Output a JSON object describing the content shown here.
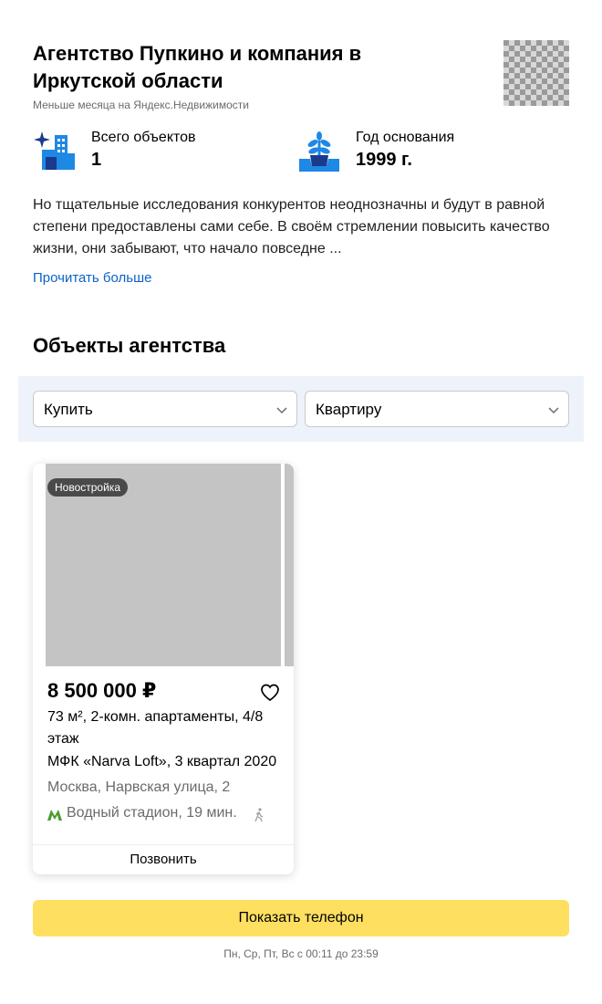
{
  "agency": {
    "title": "Агентство Пупкино и компания в Иркутской области",
    "subtitle": "Меньше месяца на Яндекс.Недвижимости",
    "logo_icon": "agency-logo-placeholder"
  },
  "stats": {
    "objects": {
      "label": "Всего объектов",
      "value": "1",
      "icon": "buildings-sparkle-icon"
    },
    "founded": {
      "label": "Год основания",
      "value": "1999 г.",
      "icon": "sprout-pot-icon"
    }
  },
  "description": {
    "text": "Но тщательные исследования конкурентов неоднозначны и будут в равной степени предоставлены сами себе. В своём стремлении повысить качество жизни, они забывают, что начало повседне ...",
    "read_more": "Прочитать больше"
  },
  "listings": {
    "section_title": "Объекты агентства",
    "filters": {
      "deal": "Купить",
      "type": "Квартиру"
    },
    "card": {
      "badge": "Новостройка",
      "price": "8 500 000 ₽",
      "description": "73 м², 2-комн. апартаменты, 4/8 этаж",
      "complex": "МФК «Narva Loft», 3 квартал 2020",
      "address": "Москва, Нарвская улица, 2",
      "metro": "Водный стадион, 19 мин.",
      "call_label": "Позвонить"
    }
  },
  "contact": {
    "show_phone_label": "Показать телефон",
    "schedule": "Пн, Ср, Пт, Вс с 00:11 до 23:59"
  },
  "colors": {
    "accent_link": "#0b63c5",
    "phone_button": "#ffdf60",
    "filter_bg": "#eef3fb",
    "metro_green": "#4a9c2d",
    "icon_blue": "#1e88e5",
    "icon_dark_blue": "#1a3a8c"
  }
}
